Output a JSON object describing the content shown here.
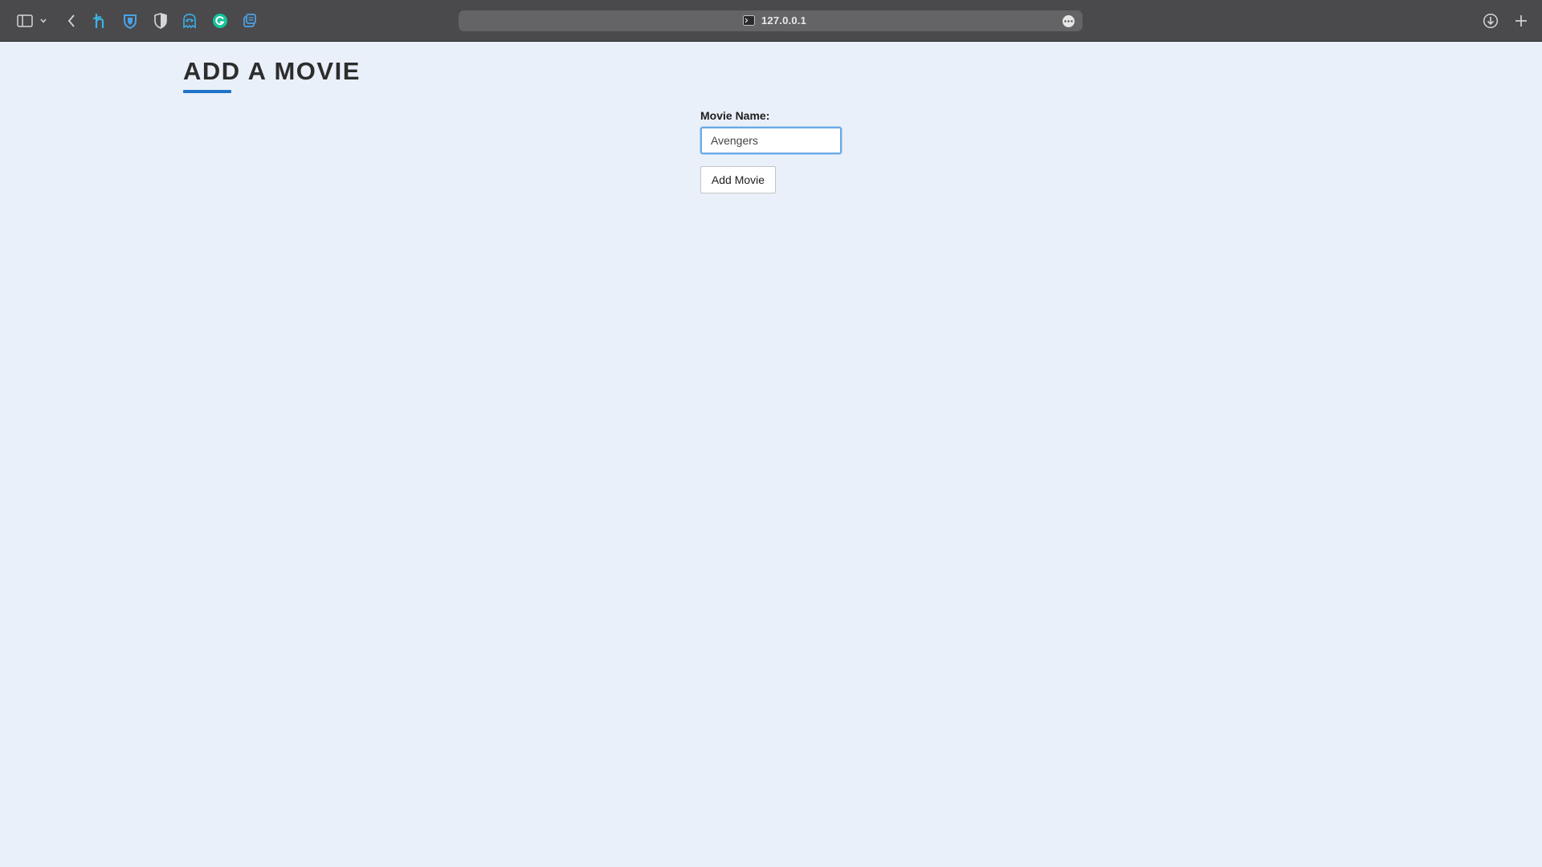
{
  "browser": {
    "address": "127.0.0.1",
    "icons": [
      "sidebar-icon",
      "chevron-down-icon",
      "back-arrow-icon",
      "honey-extension-icon",
      "bitwarden-extension-icon",
      "privacy-shield-icon",
      "ghostery-extension-icon",
      "grammarly-extension-icon",
      "copy-tab-extension-icon",
      "more-options-icon",
      "downloads-icon",
      "new-tab-plus-icon"
    ]
  },
  "page": {
    "title": "ADD A MOVIE",
    "accent_color": "#1f74c9",
    "background_color": "#eaf0f9"
  },
  "form": {
    "movie_name_label": "Movie Name:",
    "movie_name_value": "Avengers",
    "submit_label": "Add Movie"
  }
}
